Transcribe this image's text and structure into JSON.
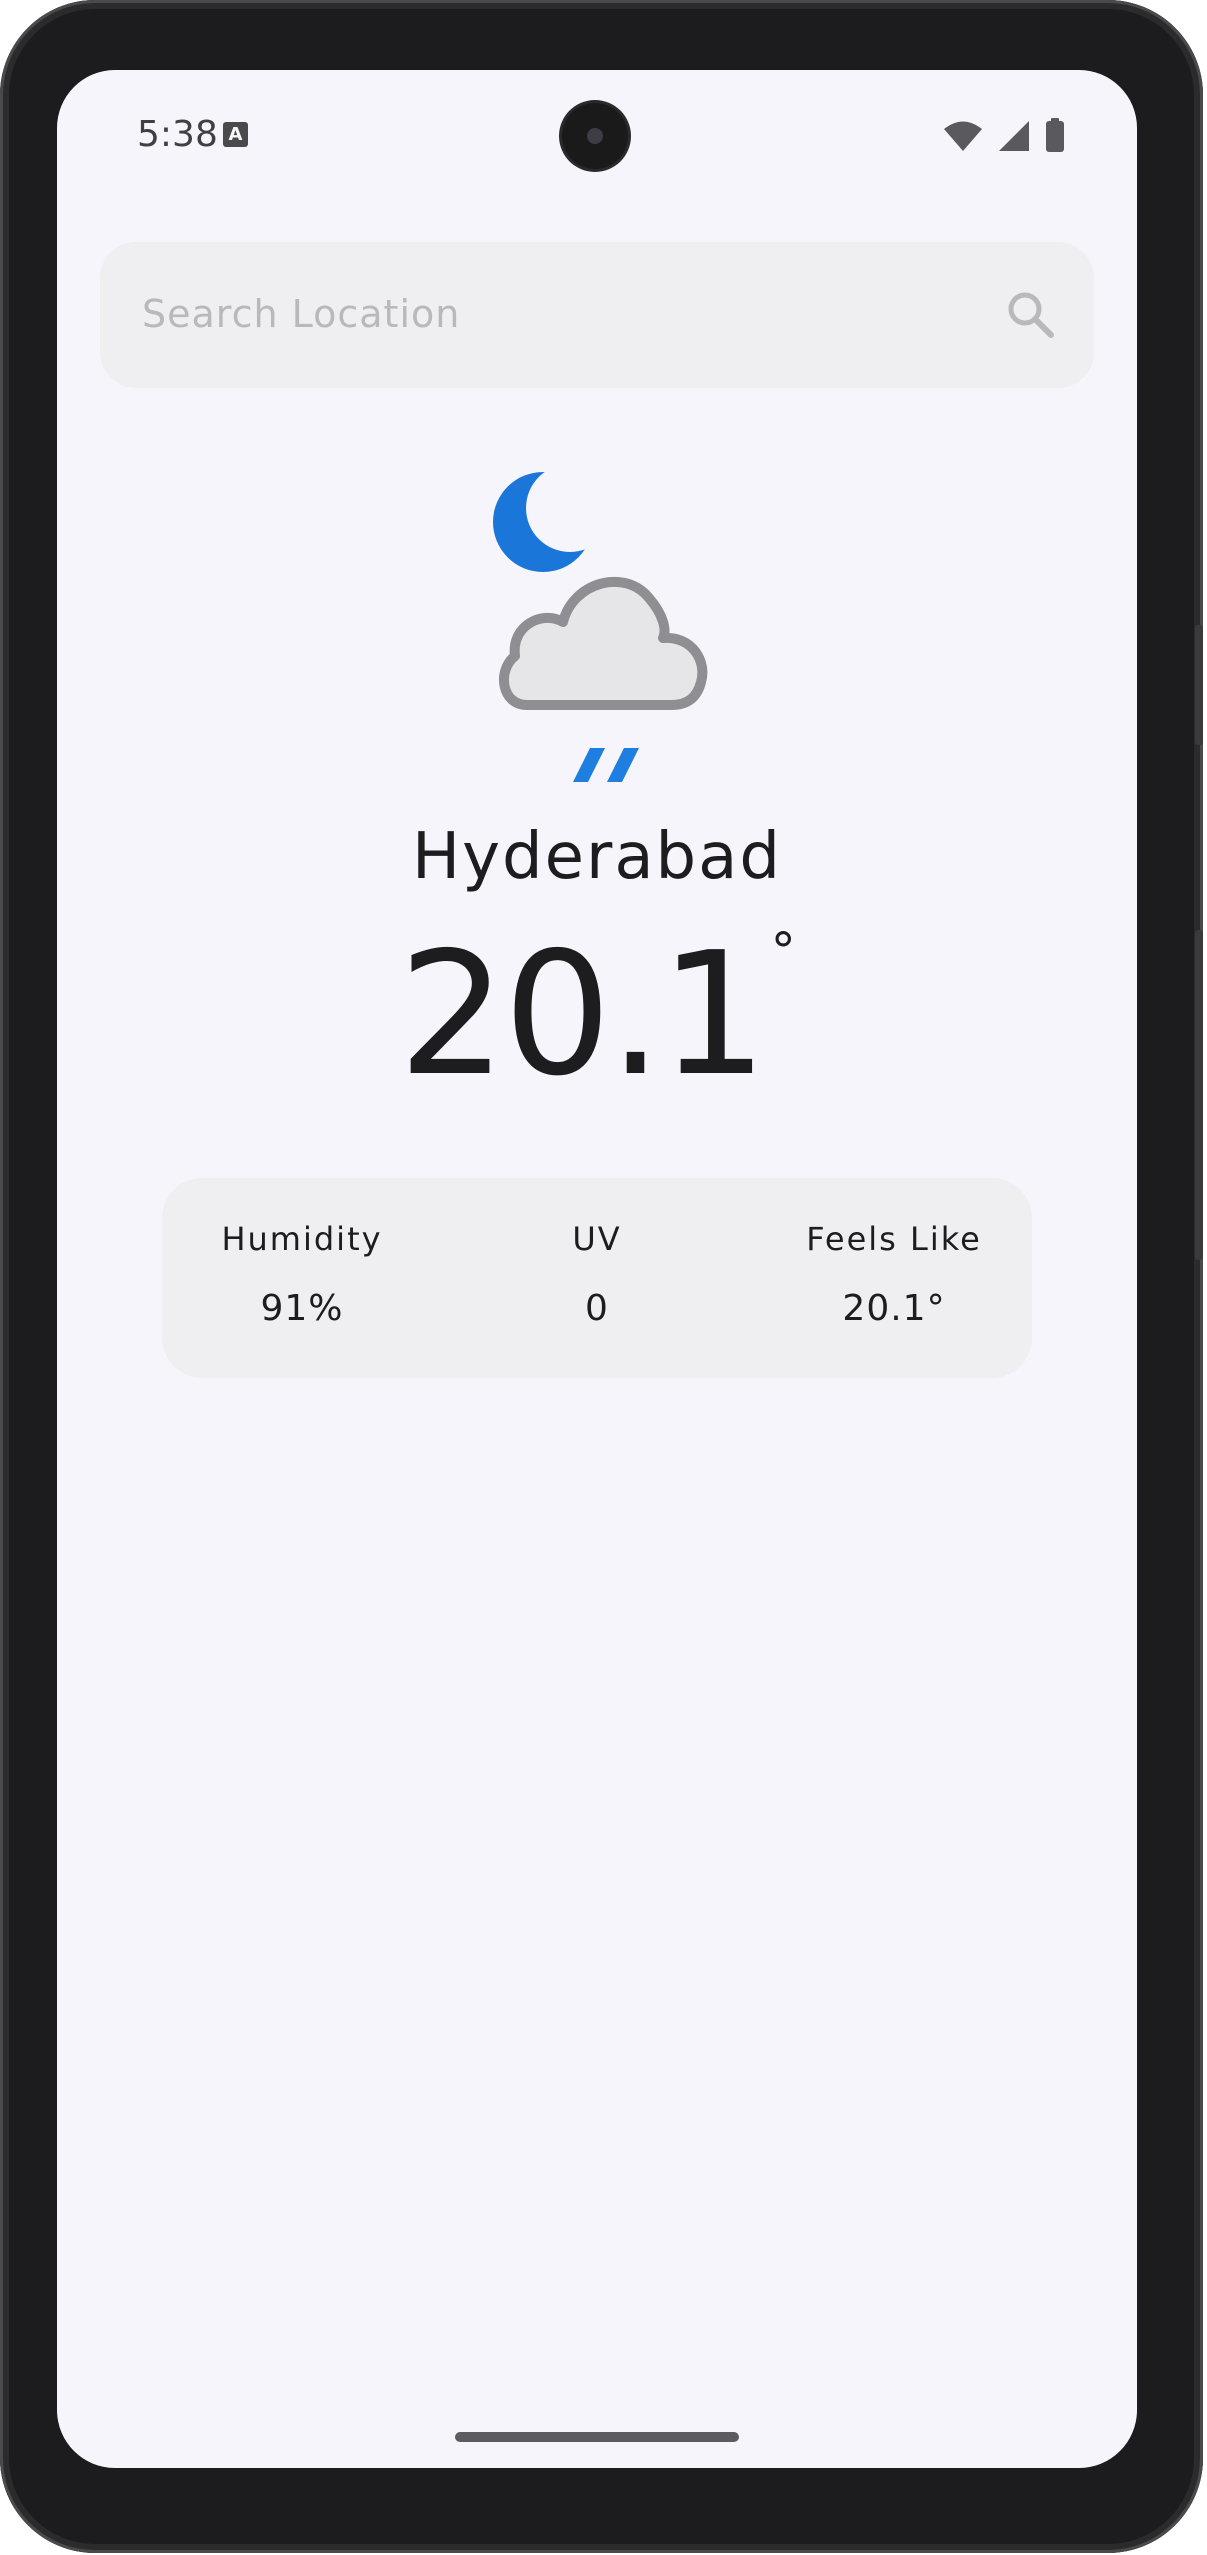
{
  "status_bar": {
    "time": "5:38",
    "notification_icon": "A"
  },
  "search": {
    "placeholder": "Search Location"
  },
  "weather": {
    "condition_icon": "night-rain-icon",
    "city": "Hyderabad",
    "temperature": "20.1",
    "temperature_unit": "°"
  },
  "stats": [
    {
      "label": "Humidity",
      "value": "91%"
    },
    {
      "label": "UV",
      "value": "0"
    },
    {
      "label": "Feels Like",
      "value": "20.1°"
    }
  ],
  "colors": {
    "accent_blue": "#1f7fe0",
    "cloud_outline": "#8f8f93",
    "cloud_fill": "#e6e6e9",
    "background": "#f6f5fb",
    "card": "#efeff1",
    "text": "#1d1d20"
  }
}
